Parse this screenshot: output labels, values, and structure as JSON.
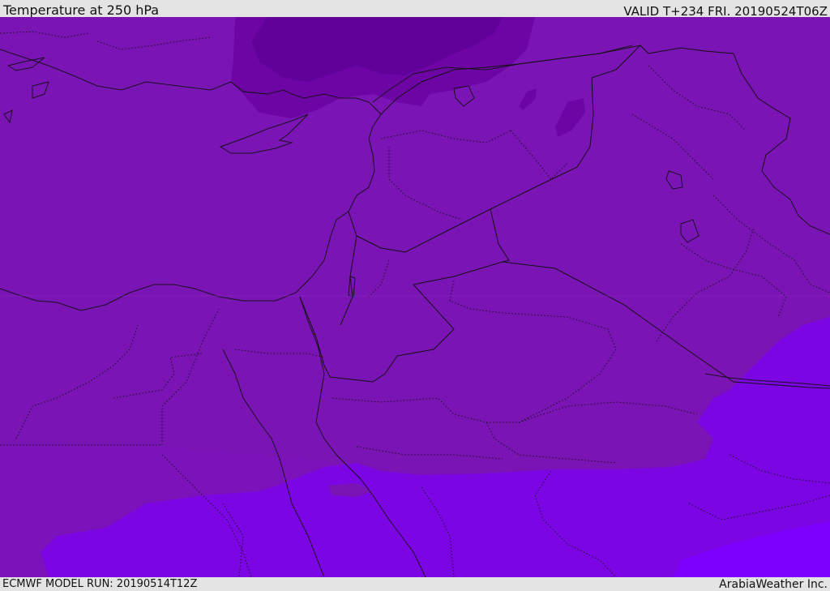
{
  "header": {
    "title": "Temperature at 250 hPa",
    "valid_time": "VALID T+234 FRI. 20190524T06Z"
  },
  "footer": {
    "model_run": "ECMWF MODEL RUN: 20190514T12Z",
    "credit": "ArabiaWeather Inc."
  },
  "map": {
    "colors": {
      "base": "#7a14b4",
      "dark": "#6c05a4",
      "darker": "#5e0096",
      "south_band": "#7d10bf",
      "light": "#7b05e6",
      "lightest": "#7d00ff",
      "border": "#141014",
      "coast": "#1a1020"
    }
  }
}
